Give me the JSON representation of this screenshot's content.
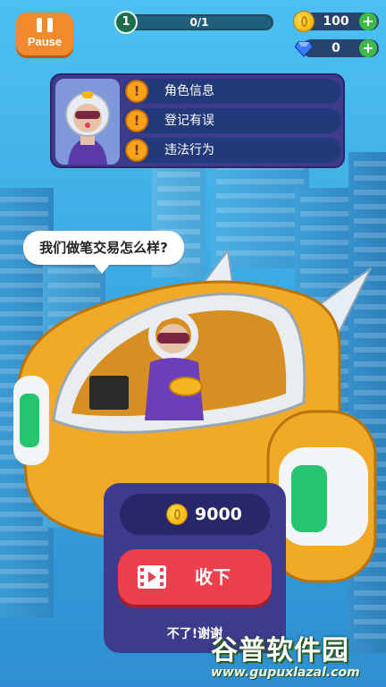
{
  "hud": {
    "pause_label": "Pause",
    "level": "1",
    "progress": "0/1",
    "coins": "100",
    "gems": "0"
  },
  "info_panel": {
    "rows": [
      {
        "label": "角色信息"
      },
      {
        "label": "登记有误"
      },
      {
        "label": "违法行为"
      }
    ]
  },
  "speech_bubble": "我们做笔交易怎么样?",
  "reward": {
    "amount": "9000",
    "accept_label": "收下",
    "decline_label": "不了!谢谢"
  },
  "watermark": {
    "title": "谷普软件园",
    "url": "www.gupuxlazal.com"
  },
  "colors": {
    "accent_orange": "#f08a2c",
    "panel_purple": "#3e3a8c",
    "accept_red": "#ee3f4c",
    "warning_yellow": "#f7a21b"
  },
  "icons": [
    "pause-icon",
    "coin-icon",
    "gem-icon",
    "plus-icon",
    "warning-icon",
    "video-icon"
  ]
}
